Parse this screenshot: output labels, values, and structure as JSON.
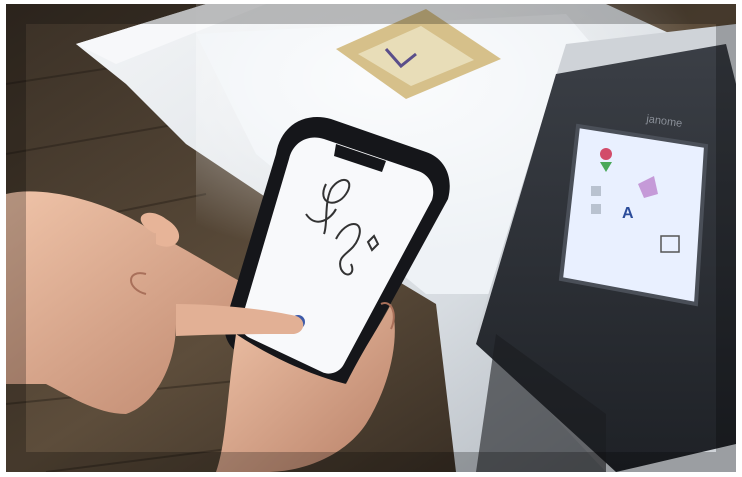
{
  "photo": {
    "subject": "",
    "machine_brand": "janome",
    "phone_screen": {
      "header": "",
      "drawing": "signature-sketch"
    },
    "colors": {
      "wood_dark": "#2a221b",
      "wood_light": "#6b5a44",
      "machine_white": "#e9ecef",
      "machine_gray": "#9aa0a8",
      "screen_glow": "#e9f0ff",
      "skin": "#d9a98d",
      "phone_black": "#15161a",
      "panel_dark": "#22252b"
    }
  }
}
